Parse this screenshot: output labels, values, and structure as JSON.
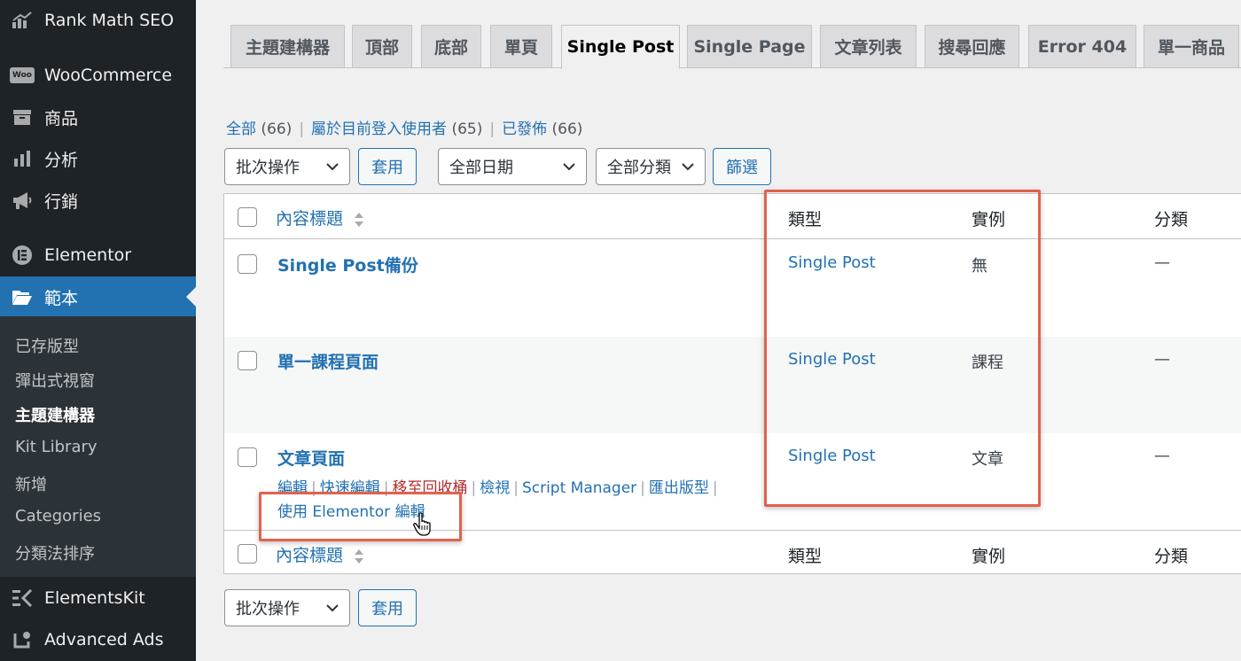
{
  "sidebar": {
    "top_items": [
      {
        "label": "Rank Math SEO",
        "icon": "rank-math-icon"
      },
      {
        "label": "WooCommerce",
        "icon": "woo-icon",
        "icon_text": "Woo"
      },
      {
        "label": "商品",
        "icon": "products-icon"
      },
      {
        "label": "分析",
        "icon": "analytics-icon"
      },
      {
        "label": "行銷",
        "icon": "megaphone-icon"
      },
      {
        "label": "Elementor",
        "icon": "elementor-icon"
      },
      {
        "label": "範本",
        "icon": "folder-icon",
        "active": true
      }
    ],
    "submenu": [
      {
        "label": "已存版型"
      },
      {
        "label": "彈出式視窗"
      },
      {
        "label": "主題建構器",
        "current": true
      },
      {
        "label": "Kit Library"
      },
      {
        "label": "新增"
      },
      {
        "label": "Categories"
      },
      {
        "label": "分類法排序"
      }
    ],
    "bottom_items": [
      {
        "label": "ElementsKit",
        "icon": "elementskit-icon"
      },
      {
        "label": "Advanced Ads",
        "icon": "advanced-ads-icon"
      }
    ]
  },
  "tabs": [
    "主題建構器",
    "頂部",
    "底部",
    "單頁",
    "Single Post",
    "Single Page",
    "文章列表",
    "搜尋回應",
    "Error 404",
    "單一商品"
  ],
  "active_tab": "Single Post",
  "views": {
    "all": {
      "label": "全部",
      "count": "(66)"
    },
    "mine": {
      "label": "屬於目前登入使用者",
      "count": "(65)"
    },
    "published": {
      "label": "已發佈",
      "count": "(66)"
    },
    "separator": "|"
  },
  "filters": {
    "bulk_action": "批次操作",
    "apply": "套用",
    "all_dates": "全部日期",
    "all_categories": "全部分類",
    "filter": "篩選"
  },
  "table": {
    "columns": {
      "title": "內容標題",
      "type": "類型",
      "instance": "實例",
      "category": "分類"
    },
    "rows": [
      {
        "title": "Single Post備份",
        "type": "Single Post",
        "instance": "無",
        "category": "—"
      },
      {
        "title": "單一課程頁面",
        "type": "Single Post",
        "instance": "課程",
        "category": "—"
      },
      {
        "title": "文章頁面",
        "type": "Single Post",
        "instance": "文章",
        "category": "—",
        "row_actions": [
          "編輯",
          "快速編輯",
          "移至回收桶",
          "檢視",
          "Script Manager",
          "匯出版型"
        ],
        "edit_with_elementor": "使用 Elementor 編輯"
      }
    ]
  },
  "colors": {
    "accent": "#2271b1",
    "sidebar": "#1d2327",
    "highlight": "#e0624f",
    "trash": "#b32d2e"
  }
}
